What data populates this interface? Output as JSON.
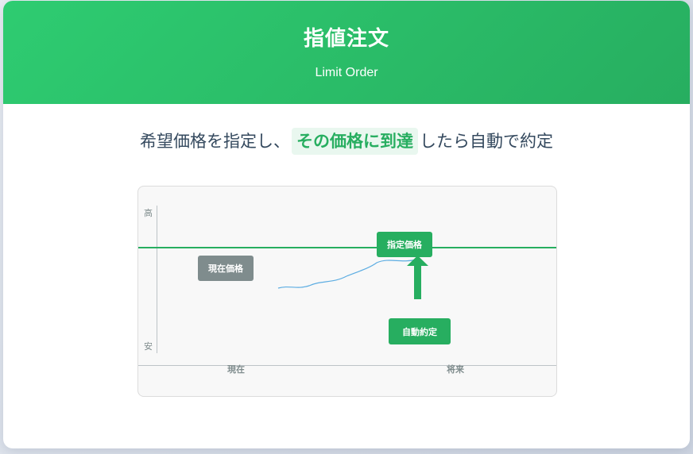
{
  "header": {
    "title": "指値注文",
    "subtitle": "Limit Order"
  },
  "lead": {
    "before": "希望価格を指定し、",
    "highlight": "その価格に到達",
    "after": "したら自動で約定"
  },
  "diagram": {
    "y_axis": {
      "high": "高",
      "low": "安"
    },
    "x_axis": {
      "start": "現在",
      "end": "将来"
    },
    "current_price_label": "現在価格",
    "limit_price_label": "指定価格",
    "auto_execution_label": "自動約定",
    "colors": {
      "accent": "#27ae60",
      "neutral": "#7f8c8d",
      "trend": "#5dade2"
    }
  }
}
